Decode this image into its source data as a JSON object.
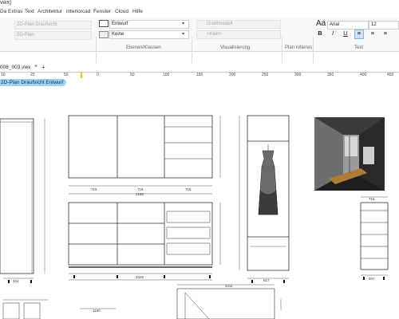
{
  "window": {
    "title": "vwx]"
  },
  "menu": [
    "Datei",
    "Extras",
    "Text",
    "Architektur",
    "interiorcad",
    "Fenster",
    "Cloud",
    "Hilfe"
  ],
  "ribbon": {
    "view_items": [
      "2D-Plan Draufsicht",
      "2D-Plan"
    ],
    "class": "Entwurf",
    "layer": "Keine",
    "group_ebenen": "Ebenen/Klassen",
    "render": "Drahtmodell",
    "render_sub": "<Kein>",
    "group_vis": "Visualisierung",
    "group_plane": "Plan rotieren",
    "font_icon": "Aa",
    "font": "Arial",
    "size": "12",
    "group_text": "Text",
    "format": [
      "B",
      "I",
      "U"
    ]
  },
  "tab": {
    "name": "008_003.vwx",
    "close": "×",
    "add": "+"
  },
  "ruler": [
    {
      "label": "10"
    },
    {
      "label": "20"
    },
    {
      "label": "50"
    },
    {
      "label": "0"
    },
    {
      "label": "50"
    },
    {
      "label": "100"
    },
    {
      "label": "150"
    },
    {
      "label": "200"
    },
    {
      "label": "250"
    },
    {
      "label": "300"
    },
    {
      "label": "350"
    },
    {
      "label": "400"
    },
    {
      "label": "450"
    }
  ],
  "plan_label": "2D-Plan Draufsicht  Entwurf",
  "dims": {
    "a": "716",
    "b": "716",
    "c": "716",
    "d": "2150",
    "e": "324",
    "f": "2026",
    "g": "617",
    "h": "607",
    "i": "1411",
    "j": "1150",
    "k": "716"
  },
  "colors": {
    "accent": "#9bd3f1",
    "marker": "#f2c200"
  }
}
